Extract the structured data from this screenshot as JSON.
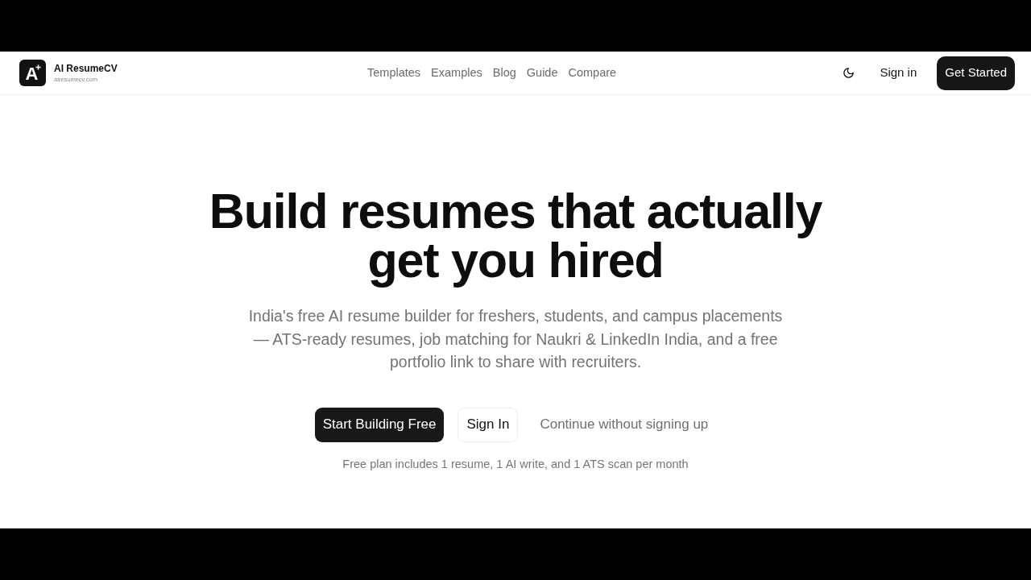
{
  "brand": {
    "mark": "A",
    "name": "AI ResumeCV",
    "domain": "airesumecv.com"
  },
  "nav": [
    "Templates",
    "Examples",
    "Blog",
    "Guide",
    "Compare"
  ],
  "header_actions": [
    {
      "kind": "link",
      "label": "Sign in"
    },
    {
      "kind": "primary",
      "label": "Get Started"
    }
  ],
  "hero": {
    "title": "Build resumes that actually get you hired",
    "subtitle": "India's free AI resume builder for freshers, students, and campus placements — ATS-ready resumes, job matching for Naukri & LinkedIn India, and a free portfolio link to share with recruiters.",
    "actions": [
      {
        "kind": "primary",
        "label": "Start Building Free"
      },
      {
        "kind": "outline",
        "label": "Sign In"
      },
      {
        "kind": "link",
        "label": "Continue without signing up"
      }
    ],
    "note": "Free plan includes 1 resume, 1 AI write, and 1 ATS scan per month"
  }
}
